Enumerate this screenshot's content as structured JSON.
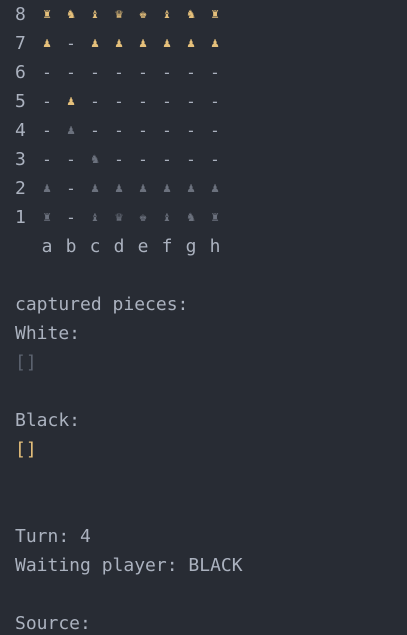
{
  "board": {
    "ranks": [
      {
        "label": "8",
        "cells": [
          {
            "g": "♜",
            "c": "w"
          },
          {
            "g": "♞",
            "c": "w"
          },
          {
            "g": "♝",
            "c": "w"
          },
          {
            "g": "♛",
            "c": "w"
          },
          {
            "g": "♚",
            "c": "w"
          },
          {
            "g": "♝",
            "c": "w"
          },
          {
            "g": "♞",
            "c": "w"
          },
          {
            "g": "♜",
            "c": "w"
          }
        ]
      },
      {
        "label": "7",
        "cells": [
          {
            "g": "♟",
            "c": "w"
          },
          {
            "g": "-",
            "c": "e"
          },
          {
            "g": "♟",
            "c": "w"
          },
          {
            "g": "♟",
            "c": "w"
          },
          {
            "g": "♟",
            "c": "w"
          },
          {
            "g": "♟",
            "c": "w"
          },
          {
            "g": "♟",
            "c": "w"
          },
          {
            "g": "♟",
            "c": "w"
          }
        ]
      },
      {
        "label": "6",
        "cells": [
          {
            "g": "-",
            "c": "e"
          },
          {
            "g": "-",
            "c": "e"
          },
          {
            "g": "-",
            "c": "e"
          },
          {
            "g": "-",
            "c": "e"
          },
          {
            "g": "-",
            "c": "e"
          },
          {
            "g": "-",
            "c": "e"
          },
          {
            "g": "-",
            "c": "e"
          },
          {
            "g": "-",
            "c": "e"
          }
        ]
      },
      {
        "label": "5",
        "cells": [
          {
            "g": "-",
            "c": "e"
          },
          {
            "g": "♟",
            "c": "w"
          },
          {
            "g": "-",
            "c": "e"
          },
          {
            "g": "-",
            "c": "e"
          },
          {
            "g": "-",
            "c": "e"
          },
          {
            "g": "-",
            "c": "e"
          },
          {
            "g": "-",
            "c": "e"
          },
          {
            "g": "-",
            "c": "e"
          }
        ]
      },
      {
        "label": "4",
        "cells": [
          {
            "g": "-",
            "c": "e"
          },
          {
            "g": "♟",
            "c": "b"
          },
          {
            "g": "-",
            "c": "e"
          },
          {
            "g": "-",
            "c": "e"
          },
          {
            "g": "-",
            "c": "e"
          },
          {
            "g": "-",
            "c": "e"
          },
          {
            "g": "-",
            "c": "e"
          },
          {
            "g": "-",
            "c": "e"
          }
        ]
      },
      {
        "label": "3",
        "cells": [
          {
            "g": "-",
            "c": "e"
          },
          {
            "g": "-",
            "c": "e"
          },
          {
            "g": "♞",
            "c": "b"
          },
          {
            "g": "-",
            "c": "e"
          },
          {
            "g": "-",
            "c": "e"
          },
          {
            "g": "-",
            "c": "e"
          },
          {
            "g": "-",
            "c": "e"
          },
          {
            "g": "-",
            "c": "e"
          }
        ]
      },
      {
        "label": "2",
        "cells": [
          {
            "g": "♟",
            "c": "b"
          },
          {
            "g": "-",
            "c": "e"
          },
          {
            "g": "♟",
            "c": "b"
          },
          {
            "g": "♟",
            "c": "b"
          },
          {
            "g": "♟",
            "c": "b"
          },
          {
            "g": "♟",
            "c": "b"
          },
          {
            "g": "♟",
            "c": "b"
          },
          {
            "g": "♟",
            "c": "b"
          }
        ]
      },
      {
        "label": "1",
        "cells": [
          {
            "g": "♜",
            "c": "b"
          },
          {
            "g": "-",
            "c": "e"
          },
          {
            "g": "♝",
            "c": "b"
          },
          {
            "g": "♛",
            "c": "b"
          },
          {
            "g": "♚",
            "c": "b"
          },
          {
            "g": "♝",
            "c": "b"
          },
          {
            "g": "♞",
            "c": "b"
          },
          {
            "g": "♜",
            "c": "b"
          }
        ]
      }
    ],
    "files": [
      "a",
      "b",
      "c",
      "d",
      "e",
      "f",
      "g",
      "h"
    ]
  },
  "captured": {
    "heading": "captured pieces:",
    "white_label": "White:",
    "white_list": "[]",
    "black_label": "Black:",
    "black_list": "[]"
  },
  "status": {
    "turn": "Turn: 4",
    "waiting": "Waiting player: BLACK",
    "source_prompt": "Source:"
  },
  "colors": {
    "background": "#282c34",
    "text": "#abb2bf",
    "white_pieces": "#e5c07b",
    "black_pieces": "#6b717d"
  }
}
